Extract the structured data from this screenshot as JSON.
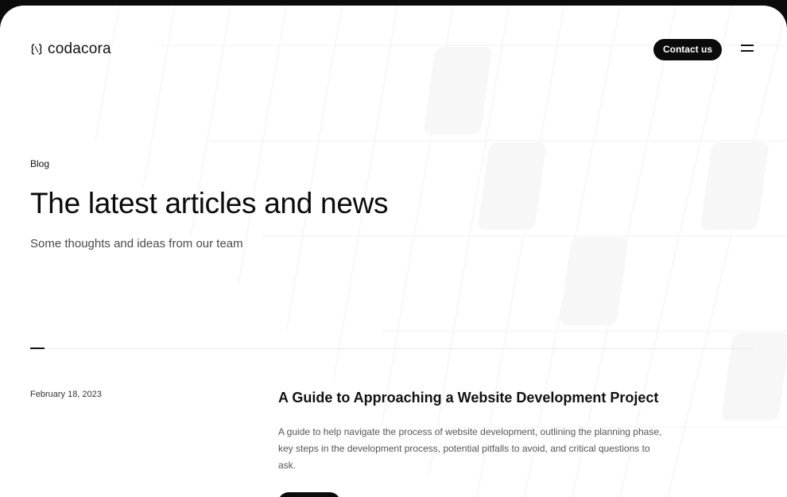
{
  "header": {
    "logo_text": "codacora",
    "contact_label": "Contact us"
  },
  "hero": {
    "eyebrow": "Blog",
    "title": "The latest articles and news",
    "subtitle": "Some thoughts and ideas from our team"
  },
  "articles": [
    {
      "date": "February 18, 2023",
      "title": "A Guide to Approaching a Website Development Project",
      "description": "A guide to help navigate the process of website development, outlining the planning phase, key steps in the development process, potential pitfalls to avoid, and critical questions to ask."
    }
  ],
  "icons": {
    "logo": "logo-icon",
    "menu": "hamburger-menu-icon"
  },
  "colors": {
    "background": "#ffffff",
    "frame": "#0b0b0b",
    "button": "#0b0b0b",
    "text": "#111111",
    "muted": "#555555"
  }
}
